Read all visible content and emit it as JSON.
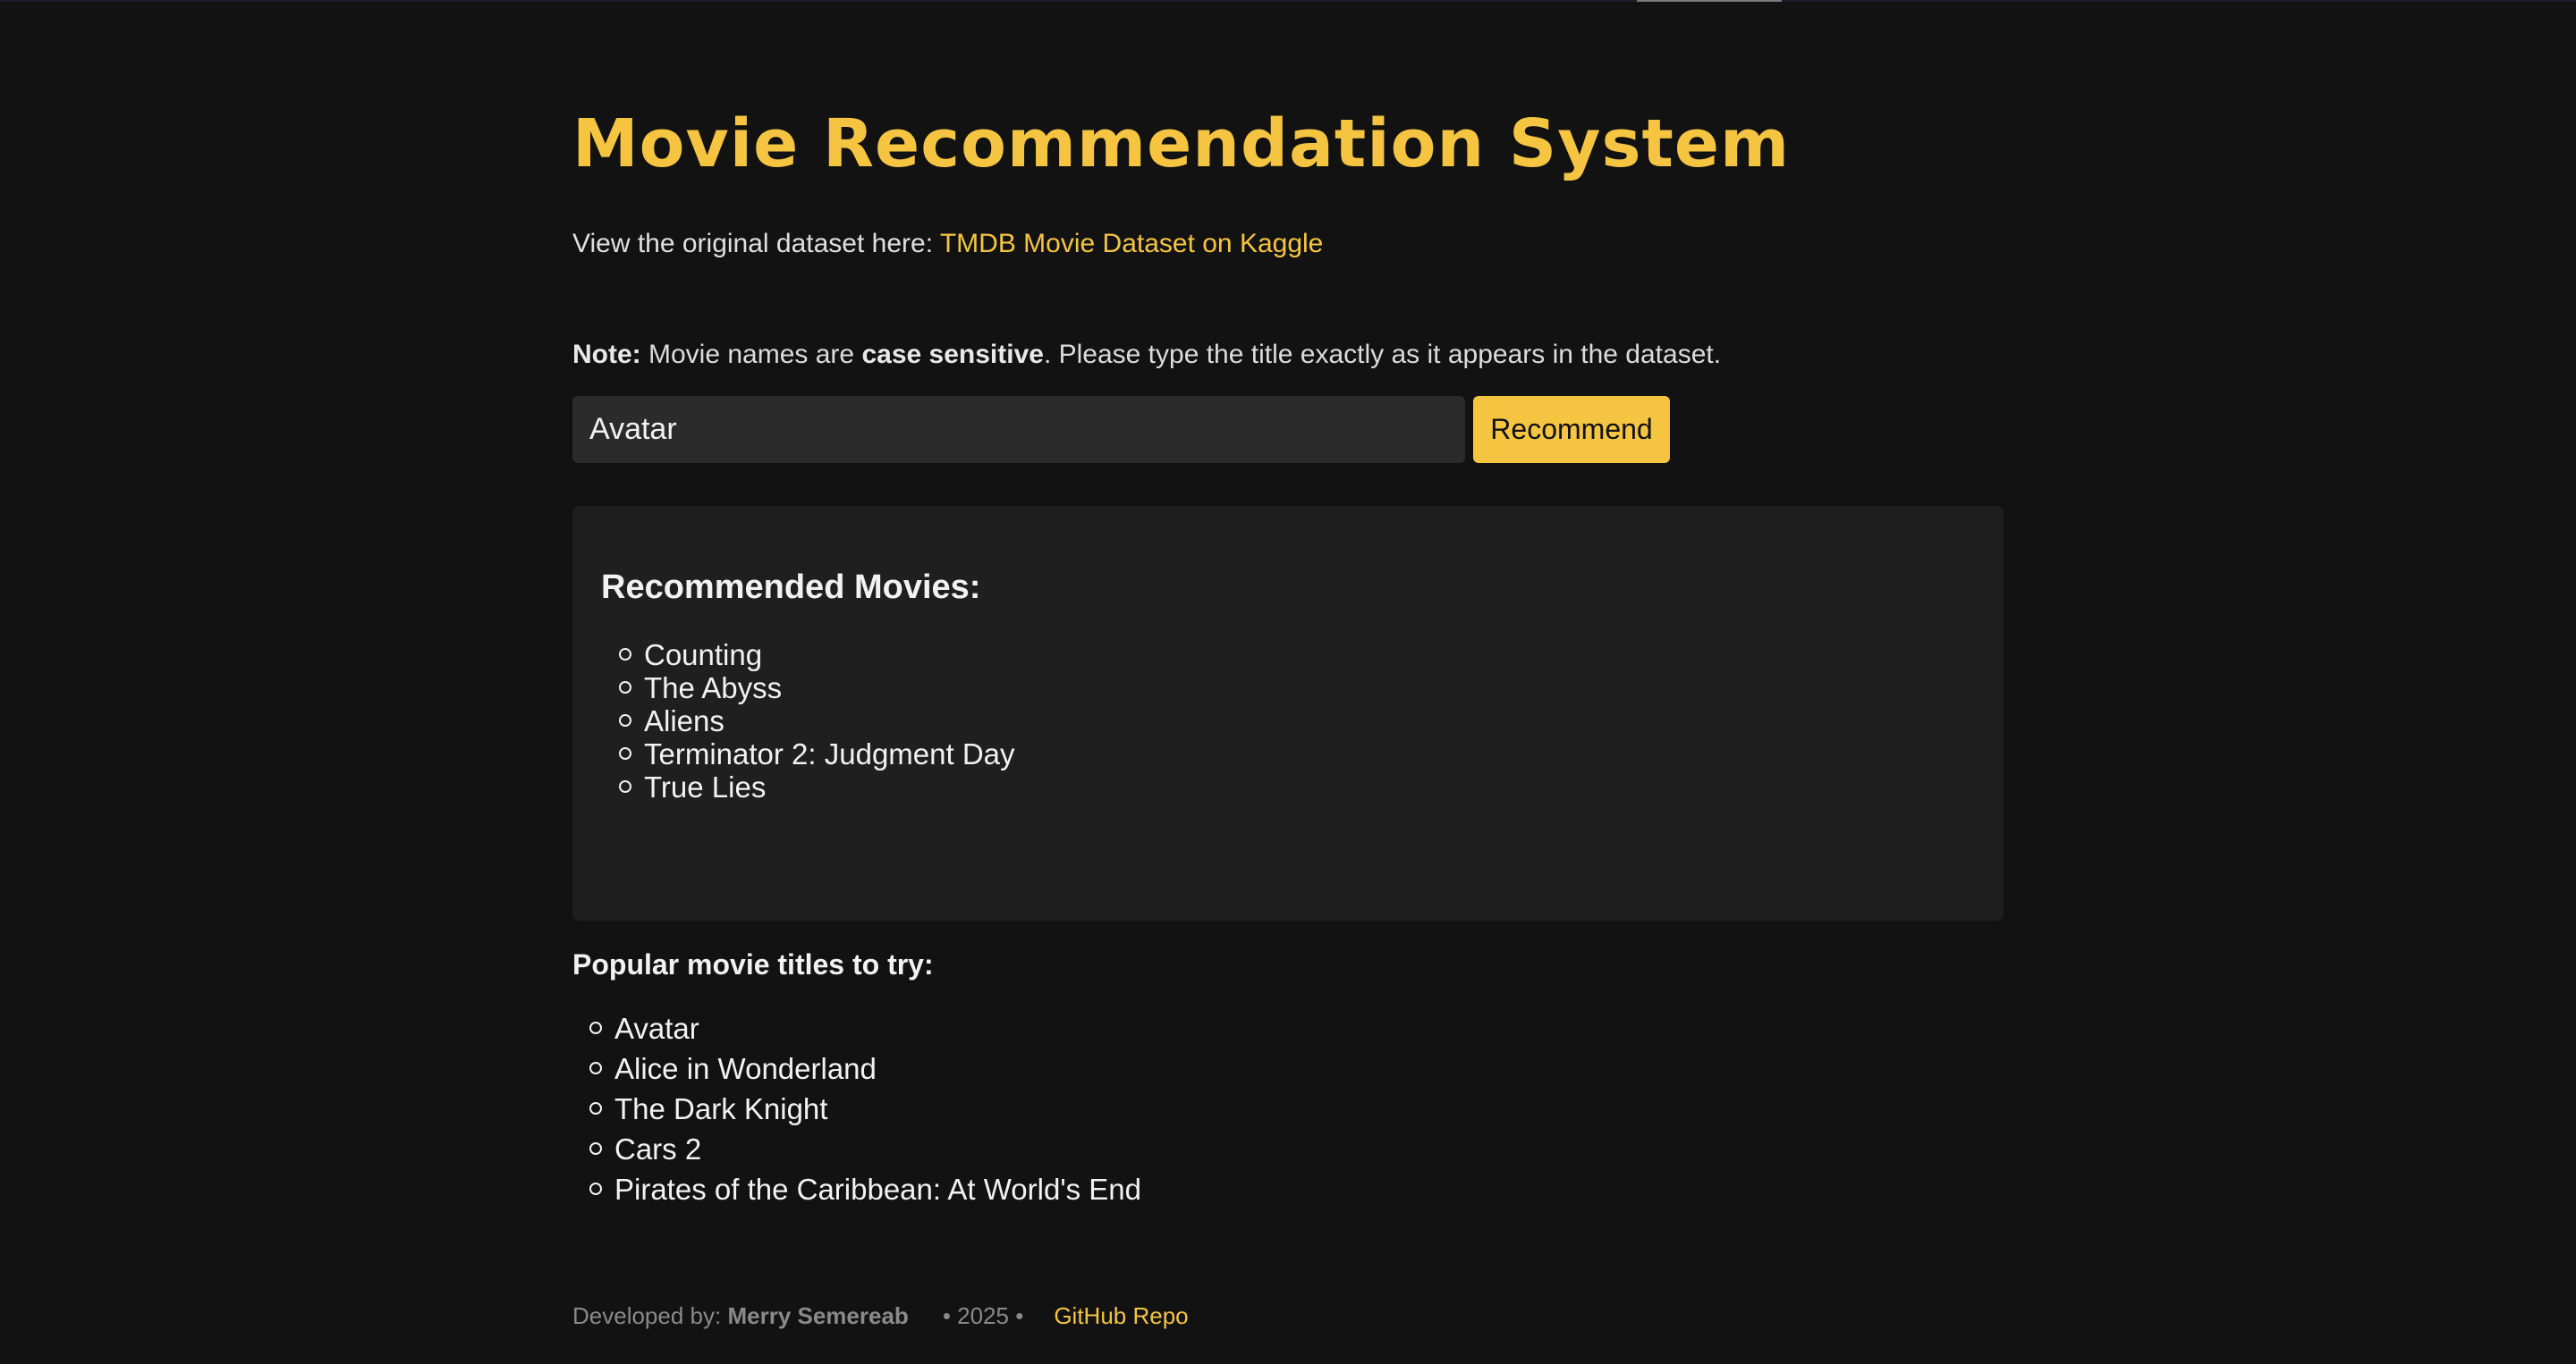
{
  "header": {
    "title": "Movie Recommendation System",
    "dataset_prefix": "View the original dataset here:",
    "dataset_link": "TMDB Movie Dataset on Kaggle"
  },
  "note": {
    "label": "Note:",
    "text_a": "Movie names are",
    "emphasis": "case sensitive",
    "text_b": ". Please type the title exactly as it appears in the dataset."
  },
  "search": {
    "value": "Avatar",
    "button_label": "Recommend"
  },
  "results": {
    "heading": "Recommended Movies:",
    "items": [
      "Counting",
      "The Abyss",
      "Aliens",
      "Terminator 2: Judgment Day",
      "True Lies"
    ]
  },
  "popular": {
    "heading": "Popular movie titles to try:",
    "items": [
      "Avatar",
      "Alice in Wonderland",
      "The Dark Knight",
      "Cars 2",
      "Pirates of the Caribbean: At World's End"
    ]
  },
  "footer": {
    "dev_prefix": "Developed by:",
    "dev_name": "Merry Semereab",
    "year": "• 2025 •",
    "repo_link": "GitHub Repo"
  },
  "colors": {
    "background": "#121212",
    "accent": "#f5c542",
    "panel": "#1f1f1f",
    "input": "#2b2b2b"
  }
}
